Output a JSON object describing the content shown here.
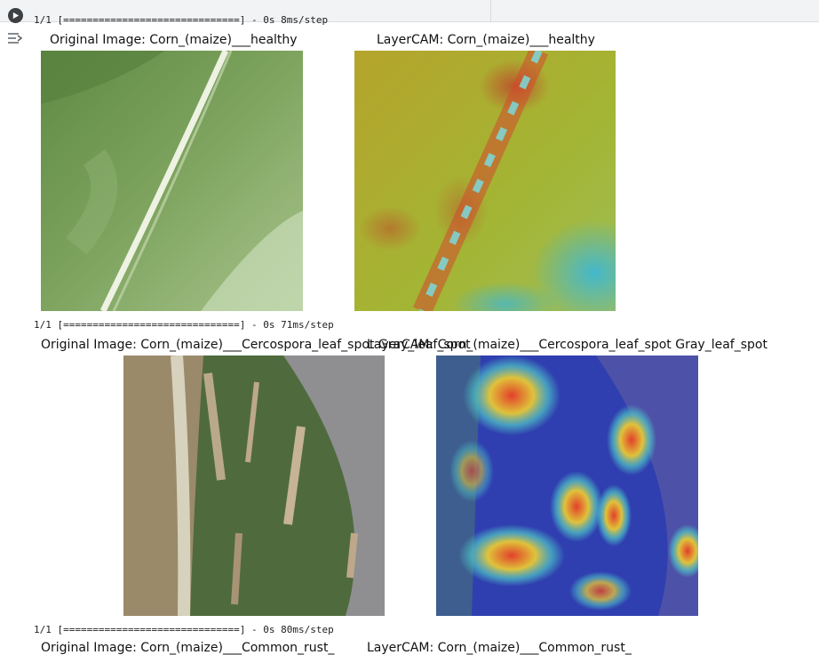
{
  "cell": {
    "run_icon": "play-circle-icon",
    "output_icon": "output-toggle-icon"
  },
  "logs": [
    "1/1 [==============================] - 0s 8ms/step",
    "1/1 [==============================] - 0s 71ms/step",
    "1/1 [==============================] - 0s 80ms/step"
  ],
  "rows": [
    {
      "original_title": "Original Image: Corn_(maize)___healthy",
      "cam_title": "LayerCAM: Corn_(maize)___healthy"
    },
    {
      "original_title": "Original Image: Corn_(maize)___Cercospora_leaf_spot Gray_leaf_spot",
      "cam_title": "LayerCAM: Corn_(maize)___Cercospora_leaf_spot Gray_leaf_spot"
    },
    {
      "original_title": "Original Image: Corn_(maize)___Common_rust_",
      "cam_title": "LayerCAM: Corn_(maize)___Common_rust_"
    }
  ],
  "colors": {
    "healthy_leaf": "#6f9a52",
    "cam_warm": "#c8b42a",
    "cam_cool": "#2c3eb0",
    "diseased_leaf": "#4d6a3e"
  }
}
